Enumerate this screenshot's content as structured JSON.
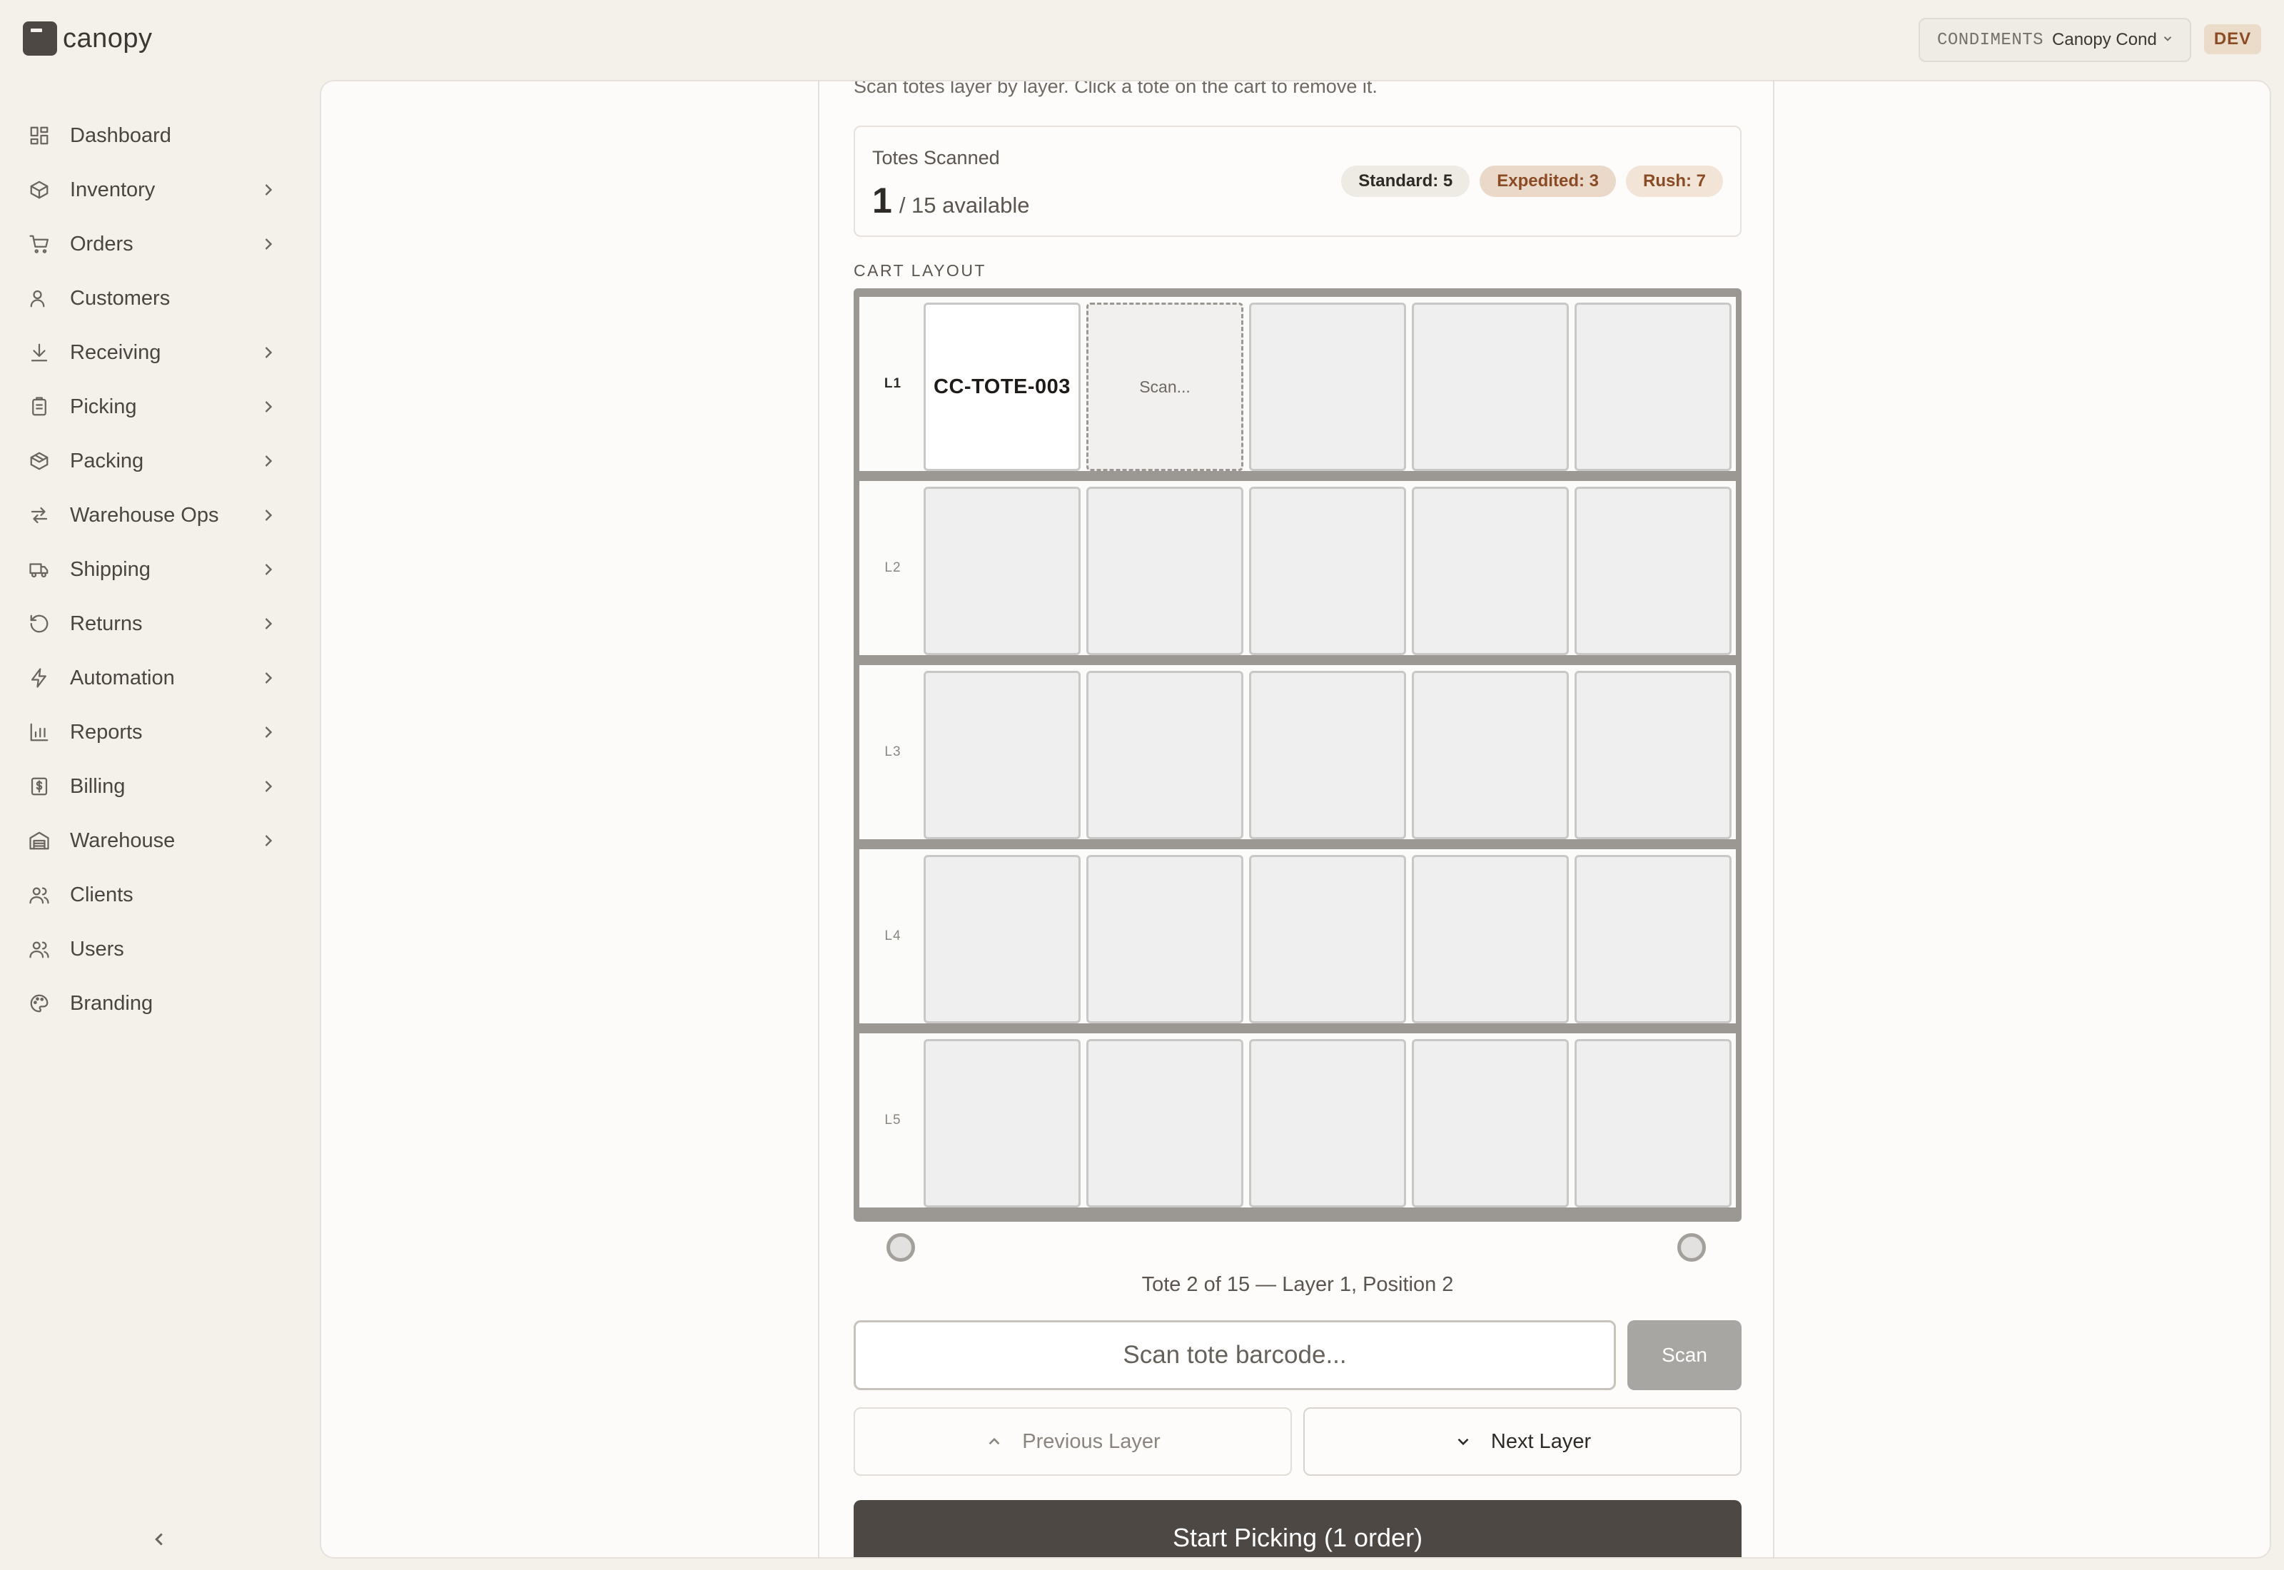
{
  "app": {
    "name": "canopy"
  },
  "tenant": {
    "code": "CONDIMENTS",
    "name": "Canopy Cond",
    "env": "DEV"
  },
  "sidebar": {
    "items": [
      {
        "label": "Dashboard",
        "icon": "dashboard-icon",
        "expandable": false
      },
      {
        "label": "Inventory",
        "icon": "box-icon",
        "expandable": true
      },
      {
        "label": "Orders",
        "icon": "cart-icon",
        "expandable": true
      },
      {
        "label": "Customers",
        "icon": "customer-icon",
        "expandable": false
      },
      {
        "label": "Receiving",
        "icon": "download-icon",
        "expandable": true
      },
      {
        "label": "Picking",
        "icon": "clipboard-icon",
        "expandable": true
      },
      {
        "label": "Packing",
        "icon": "package-icon",
        "expandable": true
      },
      {
        "label": "Warehouse Ops",
        "icon": "arrows-icon",
        "expandable": true
      },
      {
        "label": "Shipping",
        "icon": "truck-icon",
        "expandable": true
      },
      {
        "label": "Returns",
        "icon": "return-icon",
        "expandable": true
      },
      {
        "label": "Automation",
        "icon": "bolt-icon",
        "expandable": true
      },
      {
        "label": "Reports",
        "icon": "chart-icon",
        "expandable": true
      },
      {
        "label": "Billing",
        "icon": "dollar-icon",
        "expandable": true
      },
      {
        "label": "Warehouse",
        "icon": "warehouse-icon",
        "expandable": true
      },
      {
        "label": "Clients",
        "icon": "users-icon",
        "expandable": false
      },
      {
        "label": "Users",
        "icon": "users-icon",
        "expandable": false
      },
      {
        "label": "Branding",
        "icon": "palette-icon",
        "expandable": false
      }
    ]
  },
  "main": {
    "hint": "Scan totes layer by layer. Click a tote on the cart to remove it.",
    "stats": {
      "title": "Totes Scanned",
      "scanned": "1",
      "available_text": "/ 15 available",
      "standard": "Standard: 5",
      "expedited": "Expedited: 3",
      "rush": "Rush: 7"
    },
    "cart": {
      "label": "CART LAYOUT",
      "layers": [
        {
          "label": "L1",
          "active": true,
          "slots": [
            "CC-TOTE-003",
            "Scan...",
            "",
            "",
            ""
          ]
        },
        {
          "label": "L2",
          "active": false,
          "slots": [
            "",
            "",
            "",
            "",
            ""
          ]
        },
        {
          "label": "L3",
          "active": false,
          "slots": [
            "",
            "",
            "",
            "",
            ""
          ]
        },
        {
          "label": "L4",
          "active": false,
          "slots": [
            "",
            "",
            "",
            "",
            ""
          ]
        },
        {
          "label": "L5",
          "active": false,
          "slots": [
            "",
            "",
            "",
            "",
            ""
          ]
        }
      ]
    },
    "progress": "Tote 2 of 15 — Layer 1, Position 2",
    "scan": {
      "placeholder": "Scan tote barcode...",
      "button": "Scan"
    },
    "prev_layer": "Previous Layer",
    "next_layer": "Next Layer",
    "start_button": "Start Picking (1 order)"
  }
}
